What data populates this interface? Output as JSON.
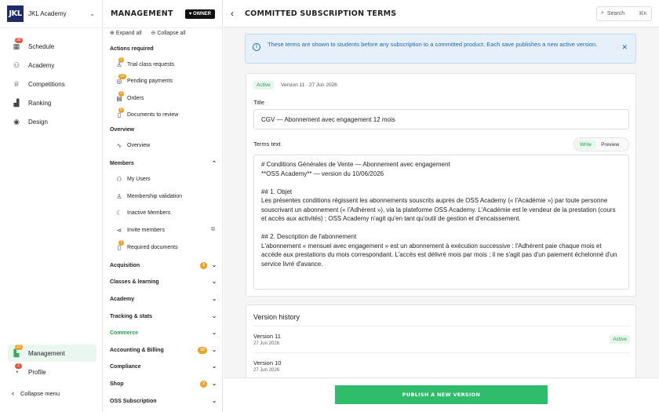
{
  "sidebar": {
    "logo_text": "JKL",
    "academy_name": "JKL Academy",
    "items": [
      {
        "label": "Schedule",
        "icon": "calendar-icon",
        "badge": "30"
      },
      {
        "label": "Academy",
        "icon": "users-icon",
        "badge": ""
      },
      {
        "label": "Competitions",
        "icon": "trophy-icon",
        "badge": ""
      },
      {
        "label": "Ranking",
        "icon": "ranking-icon",
        "badge": ""
      },
      {
        "label": "Design",
        "icon": "palette-icon",
        "badge": ""
      }
    ],
    "management": {
      "label": "Management",
      "icon": "management-icon",
      "badge": "23"
    },
    "profile": {
      "label": "Profile",
      "icon": "profile-icon",
      "badge": "2"
    },
    "collapse_label": "Collapse menu"
  },
  "management": {
    "title": "MANAGEMENT",
    "owner_badge": "OWNER",
    "expand_all": "Expand all",
    "collapse_all": "Collapse all",
    "actions_required": "Actions required",
    "actions": [
      {
        "label": "Trial class requests",
        "badge": "1"
      },
      {
        "label": "Pending payments",
        "badge": "10"
      },
      {
        "label": "Orders",
        "badge": "2"
      },
      {
        "label": "Documents to review",
        "badge": "5"
      }
    ],
    "overview_section": "Overview",
    "overview_item": "Overview",
    "members_section": "Members",
    "members": [
      {
        "label": "My Users",
        "badge": ""
      },
      {
        "label": "Membership validation",
        "badge": ""
      },
      {
        "label": "Inactive Members",
        "badge": ""
      },
      {
        "label": "Invite members",
        "badge": ""
      },
      {
        "label": "Required documents",
        "badge": "1"
      }
    ],
    "sections": [
      {
        "label": "Acquisition",
        "badge": "1"
      },
      {
        "label": "Classes & learning",
        "badge": ""
      },
      {
        "label": "Academy",
        "badge": ""
      },
      {
        "label": "Tracking & stats",
        "badge": ""
      },
      {
        "label": "Commerce",
        "badge": ""
      },
      {
        "label": "Accounting & Billing",
        "badge": "10"
      },
      {
        "label": "Compliance",
        "badge": ""
      },
      {
        "label": "Shop",
        "badge": "2"
      },
      {
        "label": "OSS Subscription",
        "badge": ""
      }
    ]
  },
  "main": {
    "page_title": "COMMITTED SUBSCRIPTION TERMS",
    "search_label": "Search",
    "search_shortcut": "⌘K",
    "info_text": "These terms are shown to students before any subscription to a committed product. Each save publishes a new active version.",
    "status_badge": "Active",
    "version_line": "Version 11 · 27 Jun 2026",
    "title_label": "Title",
    "title_value": "CGV — Abonnement avec engagement 12 mois",
    "terms_label": "Terms text",
    "write_tab": "Write",
    "preview_tab": "Preview",
    "terms_text": "# Conditions Générales de Vente — Abonnement avec engagement\n**OSS Academy** — version du 10/06/2026\n\n## 1. Objet\nLes présentes conditions régissent les abonnements souscrits auprès de OSS Academy (« l'Académie ») par toute personne souscrivant un abonnement (« l'Adhérent »), via la plateforme OSS Academy. L'Académie est le vendeur de la prestation (cours et accès aux activités) ; OSS Academy n'agit qu'en tant qu'outil de gestion et d'encaissement.\n\n## 2. Description de l'abonnement\nL'abonnement « mensuel avec engagement » est un abonnement à exécution successive : l'Adhérent paie chaque mois et accède aux prestations du mois correspondant. L'accès est délivré mois par mois ; il ne s'agit pas d'un paiement échelonné d'un service livré d'avance.",
    "history_title": "Version history",
    "history": [
      {
        "version": "Version 11",
        "date": "27 Jun 2026",
        "badge": "Active"
      },
      {
        "version": "Version 10",
        "date": "27 Jun 2026",
        "badge": ""
      }
    ],
    "publish_label": "PUBLISH A NEW VERSION"
  }
}
